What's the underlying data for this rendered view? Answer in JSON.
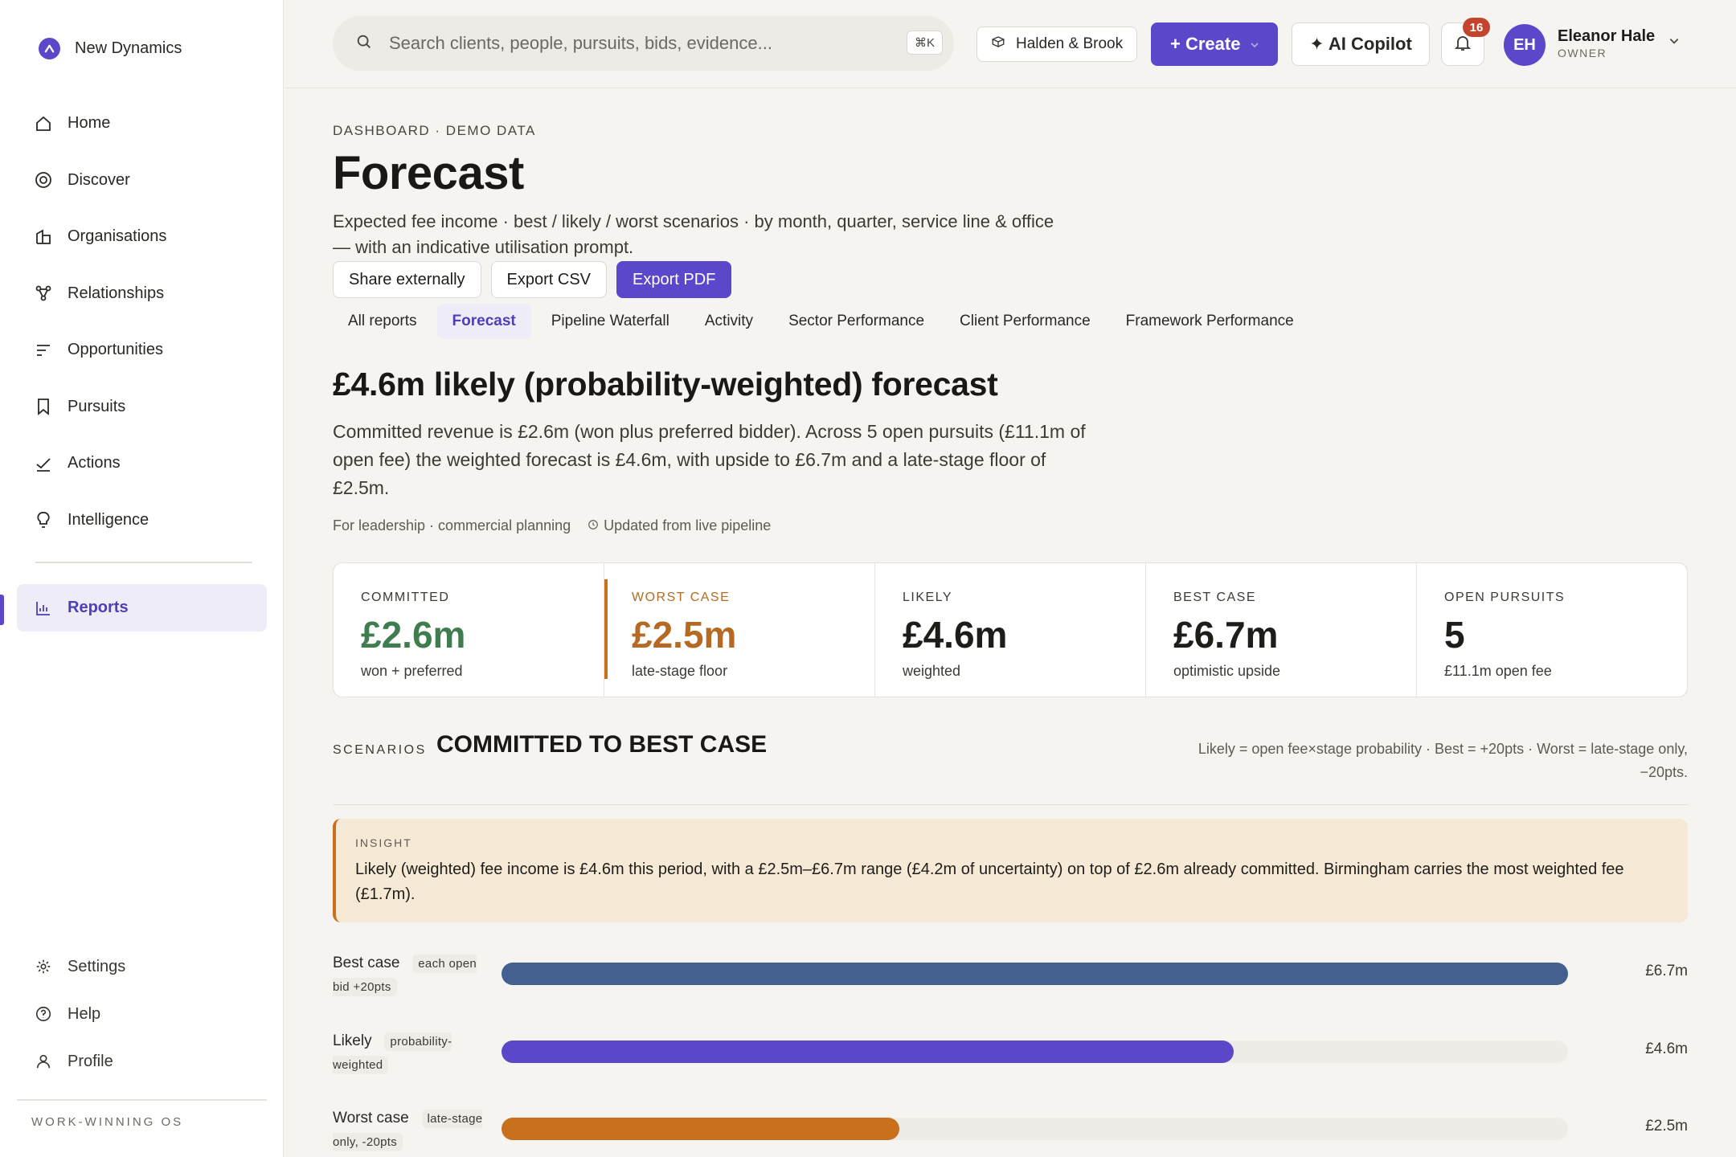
{
  "app": {
    "name": "New Dynamics",
    "tagline": "WORK-WINNING OS"
  },
  "sidebar": {
    "items": [
      {
        "label": "Home",
        "icon": "home-icon"
      },
      {
        "label": "Discover",
        "icon": "discover-icon"
      },
      {
        "label": "Organisations",
        "icon": "organisations-icon"
      },
      {
        "label": "Relationships",
        "icon": "relationships-icon"
      },
      {
        "label": "Opportunities",
        "icon": "opportunities-icon"
      },
      {
        "label": "Pursuits",
        "icon": "bookmark-icon"
      },
      {
        "label": "Actions",
        "icon": "check-icon"
      },
      {
        "label": "Intelligence",
        "icon": "lightbulb-icon"
      }
    ],
    "active": {
      "label": "Reports",
      "icon": "bar-chart-icon"
    },
    "bottom": [
      {
        "label": "Settings",
        "icon": "gear-icon"
      },
      {
        "label": "Help",
        "icon": "help-icon"
      },
      {
        "label": "Profile",
        "icon": "user-icon"
      }
    ]
  },
  "topbar": {
    "search_placeholder": "Search clients, people, pursuits, bids, evidence...",
    "shortcut": "⌘K",
    "org": "Halden & Brook",
    "create_label": "+ Create",
    "copilot_label": "✦ AI Copilot",
    "notifications": "16",
    "user": {
      "initials": "EH",
      "name": "Eleanor Hale",
      "role": "OWNER"
    }
  },
  "page": {
    "eyebrow": "DASHBOARD · DEMO DATA",
    "title": "Forecast",
    "description": "Expected fee income · best / likely / worst scenarios · by month, quarter, service line & office — with an indicative utilisation prompt.",
    "actions": {
      "share": "Share externally",
      "csv": "Export CSV",
      "pdf": "Export PDF"
    },
    "tabs": [
      "All reports",
      "Forecast",
      "Pipeline Waterfall",
      "Activity",
      "Sector Performance",
      "Client Performance",
      "Framework Performance"
    ],
    "active_tab": "Forecast",
    "headline": "£4.6m likely (probability-weighted) forecast",
    "summary": "Committed revenue is £2.6m (won plus preferred bidder). Across 5 open pursuits (£11.1m of open fee) the weighted forecast is £4.6m, with upside to £6.7m and a late-stage floor of £2.5m.",
    "audience": "For leadership · commercial planning",
    "updated": "Updated from live pipeline"
  },
  "kpis": [
    {
      "label": "COMMITTED",
      "value": "£2.6m",
      "sub": "won + preferred",
      "color": "#3f7d4e"
    },
    {
      "label": "WORST CASE",
      "value": "£2.5m",
      "sub": "late-stage floor",
      "color": "#b46a22"
    },
    {
      "label": "LIKELY",
      "value": "£4.6m",
      "sub": "weighted"
    },
    {
      "label": "BEST CASE",
      "value": "£6.7m",
      "sub": "optimistic upside"
    },
    {
      "label": "OPEN PURSUITS",
      "value": "5",
      "sub": "£11.1m open fee"
    }
  ],
  "scenarios": {
    "kicker": "SCENARIOS",
    "title": "COMMITTED TO BEST CASE",
    "note": "Likely = open fee×stage probability · Best = +20pts · Worst = late-stage only, −20pts.",
    "insight_kicker": "INSIGHT",
    "insight": "Likely (weighted) fee income is £4.6m this period, with a £2.5m–£6.7m range (£4.2m of uncertainty) on top of £2.6m already committed. Birmingham carries the most weighted fee (£1.7m).",
    "rows": [
      {
        "label": "Best case",
        "pill": "each open bid +20pts",
        "value": "£6.7m",
        "amount": 6.7,
        "color": "#43608f"
      },
      {
        "label": "Likely",
        "pill": "probability-weighted",
        "value": "£4.6m",
        "amount": 4.6,
        "color": "#5b47c9"
      },
      {
        "label": "Worst case",
        "pill": "late-stage only, -20pts",
        "value": "£2.5m",
        "amount": 2.5,
        "color": "#c9701d"
      }
    ],
    "scale_max": 6.7
  }
}
